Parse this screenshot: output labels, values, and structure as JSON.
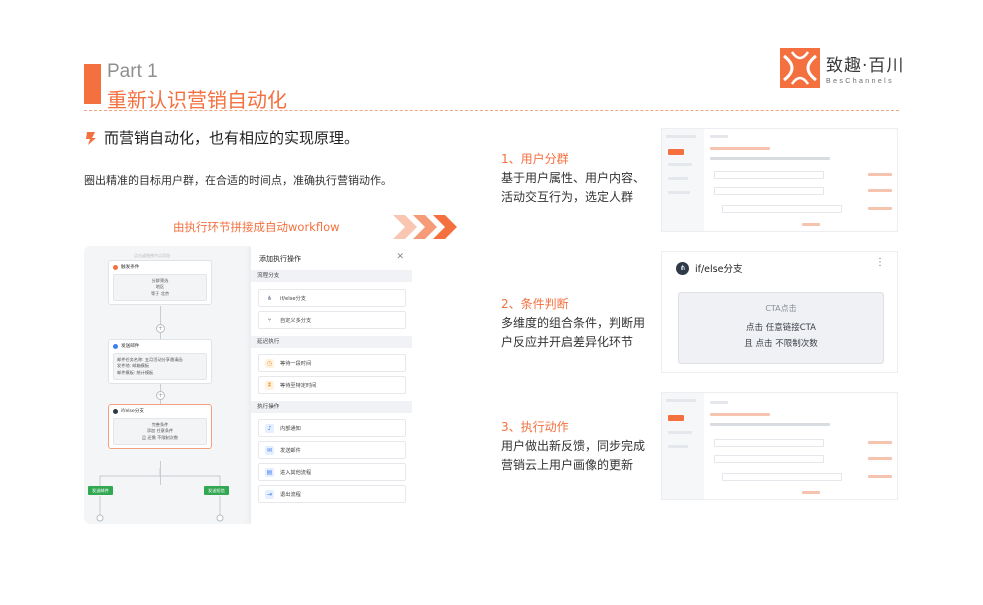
{
  "header": {
    "part_label": "Part 1",
    "title": "重新认识营销自动化",
    "accent_color": "#f4703e"
  },
  "logo": {
    "name": "致趣·百川",
    "en": "BesChannels"
  },
  "intro": {
    "headline": "而营销自动化，也有相应的实现原理。",
    "description": "圈出精准的目标用户群，在合适的时间点，准确执行营销动作。"
  },
  "workflow": {
    "label": "由执行环节拼接成自动workflow",
    "canvas": {
      "hint": "点击或拖拽节点添加",
      "trigger": {
        "title": "触发条件",
        "subtitle": "分群筛选",
        "lines": [
          "地区",
          "等于 北京"
        ]
      },
      "action": {
        "title": "发送邮件",
        "lines": [
          "邮件任务名称: 五月活动分享邀请函",
          "发件地: 邮箱模板",
          "邮件模板: 统计模板"
        ]
      },
      "ifelse": {
        "title": "if/else分支",
        "subtitle": "完善条件",
        "lines": [
          "添加 任意条件",
          "且 还需 不限制次数"
        ]
      },
      "branch_left": "发送邮件",
      "branch_right": "发送短信"
    },
    "operations": {
      "title": "添加执行操作",
      "close_icon": "close-icon",
      "sections": [
        {
          "name": "流程分支",
          "items": [
            {
              "label": "if/else分支",
              "icon": "branch-icon",
              "color": "#5b6b82"
            },
            {
              "label": "自定义多分支",
              "icon": "multi-branch-icon",
              "color": "#5b6b82"
            }
          ]
        },
        {
          "name": "延迟执行",
          "items": [
            {
              "label": "等待一段时间",
              "icon": "timer-icon",
              "color": "#f2a23c"
            },
            {
              "label": "等待至特定时间",
              "icon": "hourglass-icon",
              "color": "#f2a23c"
            }
          ]
        },
        {
          "name": "执行操作",
          "items": [
            {
              "label": "内部通知",
              "icon": "bell-icon",
              "color": "#3d7ef0"
            },
            {
              "label": "发送邮件",
              "icon": "mail-icon",
              "color": "#3d7ef0"
            },
            {
              "label": "进入其他流程",
              "icon": "enter-flow-icon",
              "color": "#3d7ef0"
            },
            {
              "label": "退出流程",
              "icon": "exit-flow-icon",
              "color": "#3d7ef0"
            }
          ]
        }
      ]
    }
  },
  "steps": [
    {
      "title": "1、用户分群",
      "lines": [
        "基于用户属性、用户内容、",
        "活动交互行为，选定人群"
      ]
    },
    {
      "title": "2、条件判断",
      "lines": [
        "多维度的组合条件，判断用",
        "户反应并开启差异化环节"
      ]
    },
    {
      "title": "3、执行动作",
      "lines": [
        "用户做出新反馈，同步完成",
        "营销云上用户画像的更新"
      ]
    }
  ],
  "ifelse_card": {
    "title": "if/else分支",
    "more_icon": "more-vertical-icon",
    "line1": "CTA点击",
    "line2": "点击 任意链接CTA",
    "line3": "且 点击 不限制次数"
  }
}
